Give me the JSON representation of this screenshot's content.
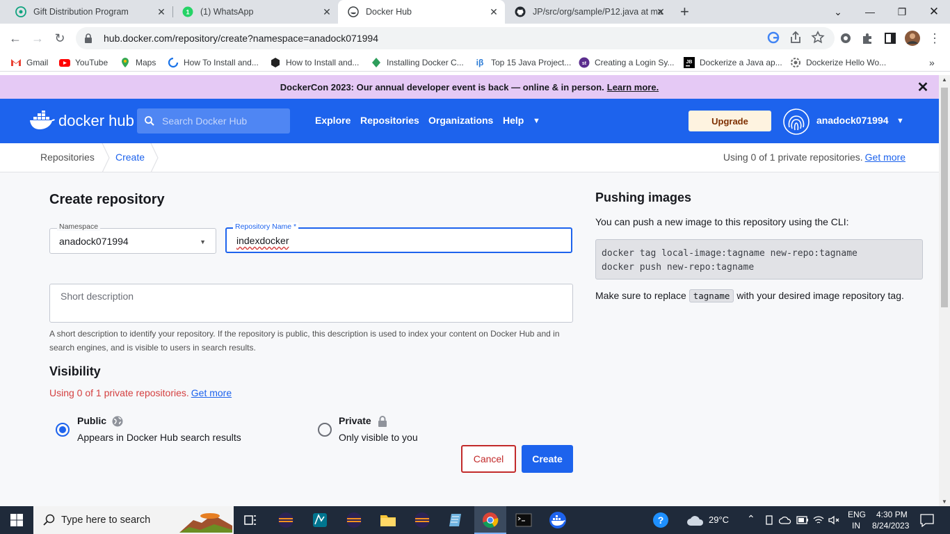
{
  "browser": {
    "tabs": [
      {
        "title": "Gift Distribution Program",
        "icon": "chatgpt-icon"
      },
      {
        "title": "(1) WhatsApp",
        "icon": "whatsapp-icon"
      },
      {
        "title": "Docker Hub",
        "icon": "docker-icon",
        "active": true
      },
      {
        "title": "JP/src/org/sample/P12.java at ma",
        "icon": "github-icon"
      }
    ],
    "url": "hub.docker.com/repository/create?namespace=anadock071994",
    "bookmarks": [
      "Gmail",
      "YouTube",
      "Maps",
      "How To Install and...",
      "How to Install and...",
      "Installing Docker C...",
      "Top 15 Java Project...",
      "Creating a Login Sy...",
      "Dockerize a Java ap...",
      "Dockerize Hello Wo..."
    ]
  },
  "banner": {
    "text": "DockerCon 2023: Our annual developer event is back — online & in person.",
    "link": "Learn more."
  },
  "hubnav": {
    "logo_text": "docker hub",
    "search_placeholder": "Search Docker Hub",
    "links": [
      "Explore",
      "Repositories",
      "Organizations",
      "Help"
    ],
    "upgrade": "Upgrade",
    "username": "anadock071994"
  },
  "breadcrumb": {
    "items": [
      "Repositories",
      "Create"
    ],
    "usage_text": "Using 0 of 1 private repositories.",
    "usage_link": "Get more"
  },
  "form": {
    "title": "Create repository",
    "namespace_label": "Namespace",
    "namespace_value": "anadock071994",
    "repo_label": "Repository Name *",
    "repo_value": "indexdocker",
    "desc_placeholder": "Short description",
    "desc_help": "A short description to identify your repository. If the repository is public, this description is used to index your content on Docker Hub and in search engines, and is visible to users in search results.",
    "visibility_title": "Visibility",
    "visibility_usage": "Using 0 of 1 private repositories.",
    "visibility_link": "Get more",
    "public_title": "Public",
    "public_desc": "Appears in Docker Hub search results",
    "private_title": "Private",
    "private_desc": "Only visible to you",
    "selected": "public",
    "cancel": "Cancel",
    "create": "Create"
  },
  "push": {
    "title": "Pushing images",
    "desc": "You can push a new image to this repository using the CLI:",
    "code": "docker tag local-image:tagname new-repo:tagname\ndocker push new-repo:tagname",
    "note_before": "Make sure to replace",
    "note_code": "tagname",
    "note_after": "with your desired image repository tag."
  },
  "taskbar": {
    "search_placeholder": "Type here to search",
    "weather": "29°C",
    "lang1": "ENG",
    "lang2": "IN",
    "time": "4:30 PM",
    "date": "8/24/2023"
  },
  "colors": {
    "docker_blue": "#1d63ed",
    "banner_bg": "#e5c9f5",
    "cancel_red": "#c22a2a"
  }
}
